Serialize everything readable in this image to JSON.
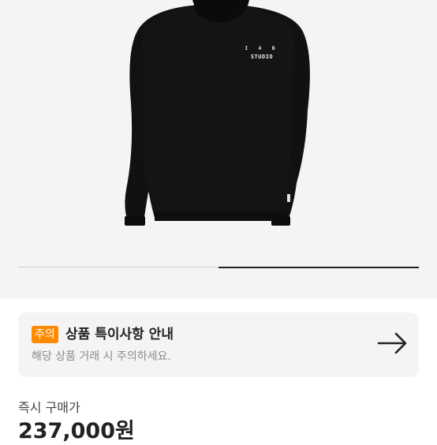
{
  "product": {
    "image_icon": "black-hoodie",
    "brand_line1": "I A B",
    "brand_line2": "STUDIO",
    "pager": {
      "current": 2,
      "total": 2
    }
  },
  "notice": {
    "badge": "주의",
    "title": "상품 특이사항 안내",
    "subtitle": "해당 상품 거래 시 주의하세요.",
    "arrow_icon": "arrow-right-icon",
    "badge_color": "#ff8a00"
  },
  "price": {
    "label": "즉시 구매가",
    "value": "237,000원"
  }
}
